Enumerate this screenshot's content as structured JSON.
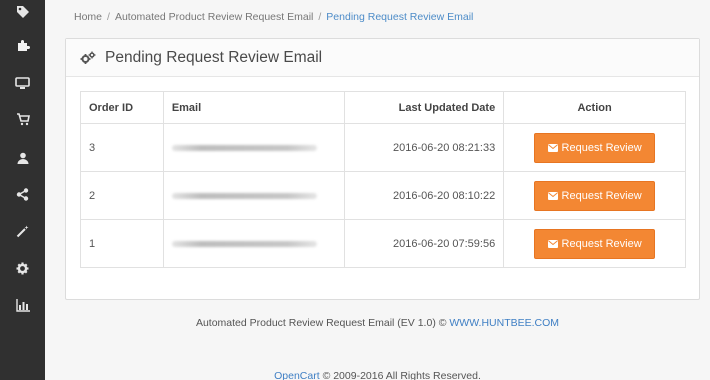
{
  "breadcrumb": {
    "home": "Home",
    "module": "Automated Product Review Request Email",
    "current": "Pending Request Review Email",
    "sep": "/"
  },
  "panel": {
    "title": "Pending Request Review Email",
    "columns": {
      "order_id": "Order ID",
      "email": "Email",
      "last_updated": "Last Updated Date",
      "action": "Action"
    },
    "rows": [
      {
        "order_id": "3",
        "date": "2016-06-20 08:21:33",
        "button": "Request Review"
      },
      {
        "order_id": "2",
        "date": "2016-06-20 08:10:22",
        "button": "Request Review"
      },
      {
        "order_id": "1",
        "date": "2016-06-20 07:59:56",
        "button": "Request Review"
      }
    ]
  },
  "footer": {
    "extension_text": "Automated Product Review Request Email (EV 1.0) ©",
    "extension_link": "WWW.HUNTBEE.COM",
    "opencart_link": "OpenCart",
    "opencart_text": "© 2009-2016 All Rights Reserved."
  },
  "sidebar_icons": [
    "tags-icon",
    "puzzle-icon",
    "desktop-icon",
    "cart-icon",
    "user-icon",
    "share-icon",
    "wand-icon",
    "gear-icon",
    "bar-chart-icon"
  ],
  "colors": {
    "sidebar_bg": "#303030",
    "accent_orange": "#f38733",
    "link_blue": "#3f7fc4"
  }
}
